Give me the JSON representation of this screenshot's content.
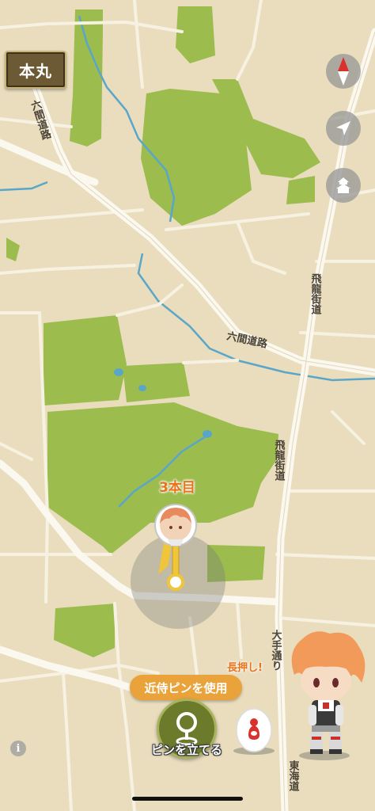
{
  "map": {
    "road_labels": {
      "rokken_vertical": "六間道路",
      "rokken_horizontal": "六間道路",
      "hiryu_upper": "飛龍街道",
      "hiryu_lower": "飛龍街道",
      "ote": "大手通り",
      "tokai": "東海道"
    }
  },
  "location_button": {
    "label": "本丸"
  },
  "controls": {
    "compass_icon": "compass-icon",
    "locate_icon": "location-arrow-icon",
    "castle_icon": "castle-icon"
  },
  "pin": {
    "count_label": "3本目"
  },
  "bottom": {
    "use_attendant_pin": "近侍ピンを使用",
    "place_pin": "ピンを立てる",
    "long_press_hint": "長押し!",
    "info": "i"
  }
}
